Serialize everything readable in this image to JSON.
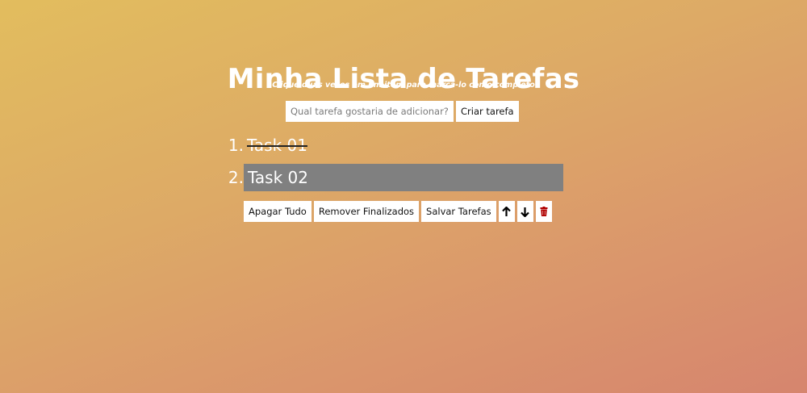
{
  "header": {
    "title": "Minha Lista de Tarefas",
    "subtitle": "Clique duas vezes em um item para marcá-lo como completo"
  },
  "add_task": {
    "placeholder": "Qual tarefa gostaria de adicionar?",
    "value": "",
    "create_label": "Criar tarefa"
  },
  "tasks": [
    {
      "number": "1.",
      "text": "Task 01",
      "completed": true,
      "selected": false
    },
    {
      "number": "2.",
      "text": "Task 02",
      "completed": false,
      "selected": true
    }
  ],
  "actions": {
    "clear_all_label": "Apagar Tudo",
    "remove_finished_label": "Remover Finalizados",
    "save_label": "Salvar Tarefas",
    "move_up_icon": "arrow-up-icon",
    "move_down_icon": "arrow-down-icon",
    "delete_icon": "trash-icon"
  },
  "colors": {
    "background_start": "#e2bd5e",
    "background_end": "#d6856e",
    "selected_task_bg": "#808080",
    "delete_icon": "#b00000"
  }
}
